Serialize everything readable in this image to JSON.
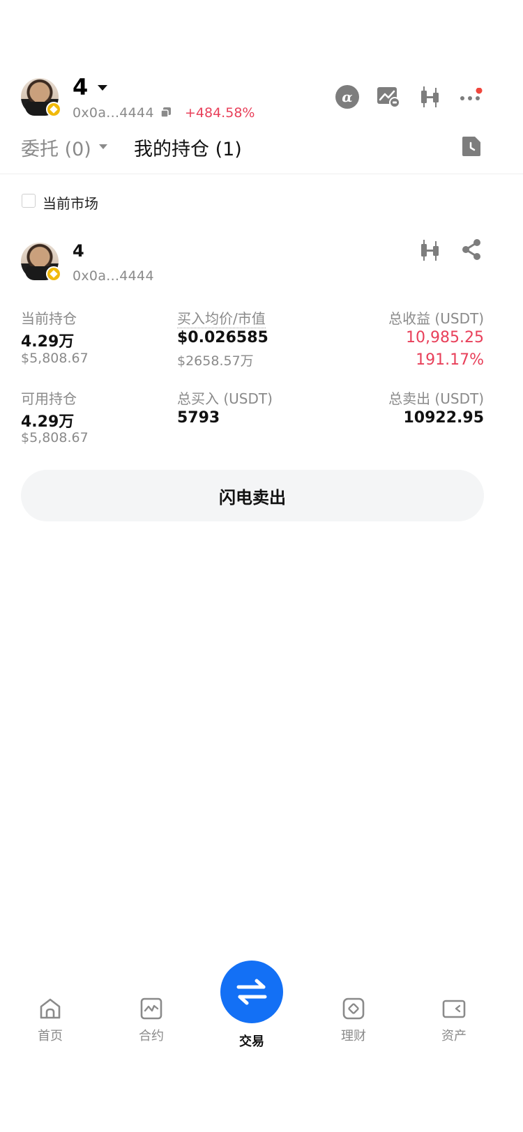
{
  "header": {
    "name": "4",
    "address": "0x0a...4444",
    "pnl_percent": "+484.58%"
  },
  "tabs": [
    {
      "label": "委托 (0)"
    },
    {
      "label": "我的持仓 (1)"
    }
  ],
  "filter": {
    "current_market_label": "当前市场"
  },
  "position": {
    "name": "4",
    "address": "0x0a...4444",
    "current_holding_label": "当前持仓",
    "current_holding_value": "4.29万",
    "current_holding_usd": "$5,808.67",
    "avg_price_label": "买入均价/市值",
    "avg_price_value": "$0.026585",
    "market_value": "$2658.57万",
    "total_profit_label": "总收益 (USDT)",
    "total_profit_value": "10,985.25",
    "total_profit_percent": "191.17%",
    "available_label": "可用持仓",
    "available_value": "4.29万",
    "available_usd": "$5,808.67",
    "total_buy_label": "总买入 (USDT)",
    "total_buy_value": "5793",
    "total_sell_label": "总卖出 (USDT)",
    "total_sell_value": "10922.95",
    "flash_sell_label": "闪电卖出"
  },
  "bottom_nav": [
    {
      "label": "首页",
      "icon": "home-icon"
    },
    {
      "label": "合约",
      "icon": "futures-icon"
    },
    {
      "label": "交易",
      "icon": "swap-icon"
    },
    {
      "label": "理财",
      "icon": "earn-icon"
    },
    {
      "label": "资产",
      "icon": "wallet-icon"
    }
  ],
  "colors": {
    "accent_blue": "#1370f5",
    "profit_red": "#e8405a",
    "notification_dot": "#f0463c"
  }
}
